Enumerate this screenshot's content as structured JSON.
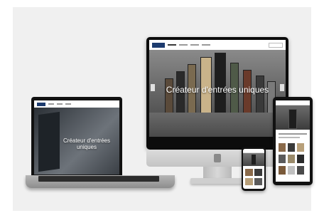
{
  "scene": {
    "background_color": "#f0f0f0",
    "imac": {
      "hero_text": "Créateur d'entrées uniques"
    },
    "laptop": {
      "hero_text": "Créateur d'entrées uniques"
    },
    "brand_color": "#1d3b6e"
  }
}
